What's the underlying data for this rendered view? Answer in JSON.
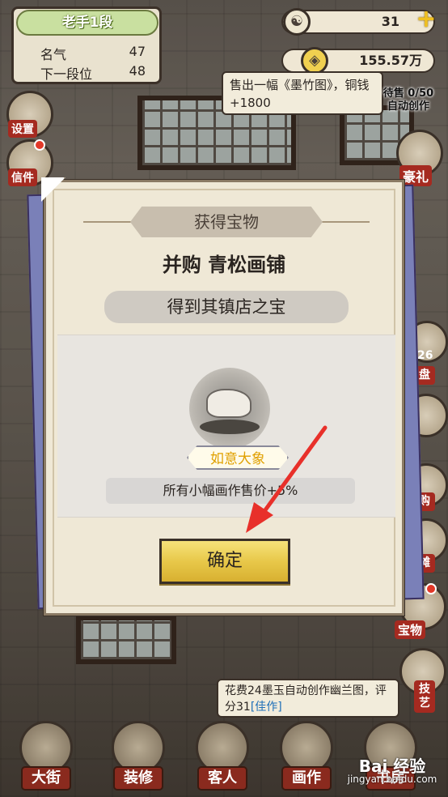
{
  "rank": {
    "title": "老手1段",
    "fame_label": "名气",
    "fame_value": "47",
    "next_label": "下一段位",
    "next_value": "48"
  },
  "currency": {
    "jade": "31",
    "coins": "155.57万"
  },
  "notice": "售出一幅《墨竹图》，铜钱+1800",
  "auto_create": {
    "line1": "待售 0/50",
    "line2": "自动创作"
  },
  "side_left": {
    "settings": "设置",
    "mail": "信件"
  },
  "side_right": {
    "gift": "豪礼",
    "timer": "26",
    "pan": "盘",
    "buy": "购",
    "stall": "摊",
    "treasure": "宝物",
    "skill": "技艺"
  },
  "log": {
    "text": "花费24墨玉自动创作幽兰图，评分31",
    "tag": "[佳作]"
  },
  "bottom_nav": [
    "大街",
    "装修",
    "客人",
    "画作",
    "书房"
  ],
  "modal": {
    "title": "获得宝物",
    "heading": "并购 青松画铺",
    "subheading": "得到其镇店之宝",
    "item_name": "如意大象",
    "effect": "所有小幅画作售价+5%",
    "confirm_label": "确定"
  },
  "watermark": {
    "brand": "Bai 经验",
    "url": "jingyan.baidu.com"
  },
  "colors": {
    "confirm": "#e8c84a",
    "tag_blue": "#1e6fb8",
    "rank_green": "#c9e0a0",
    "label_red": "#a52a20"
  }
}
